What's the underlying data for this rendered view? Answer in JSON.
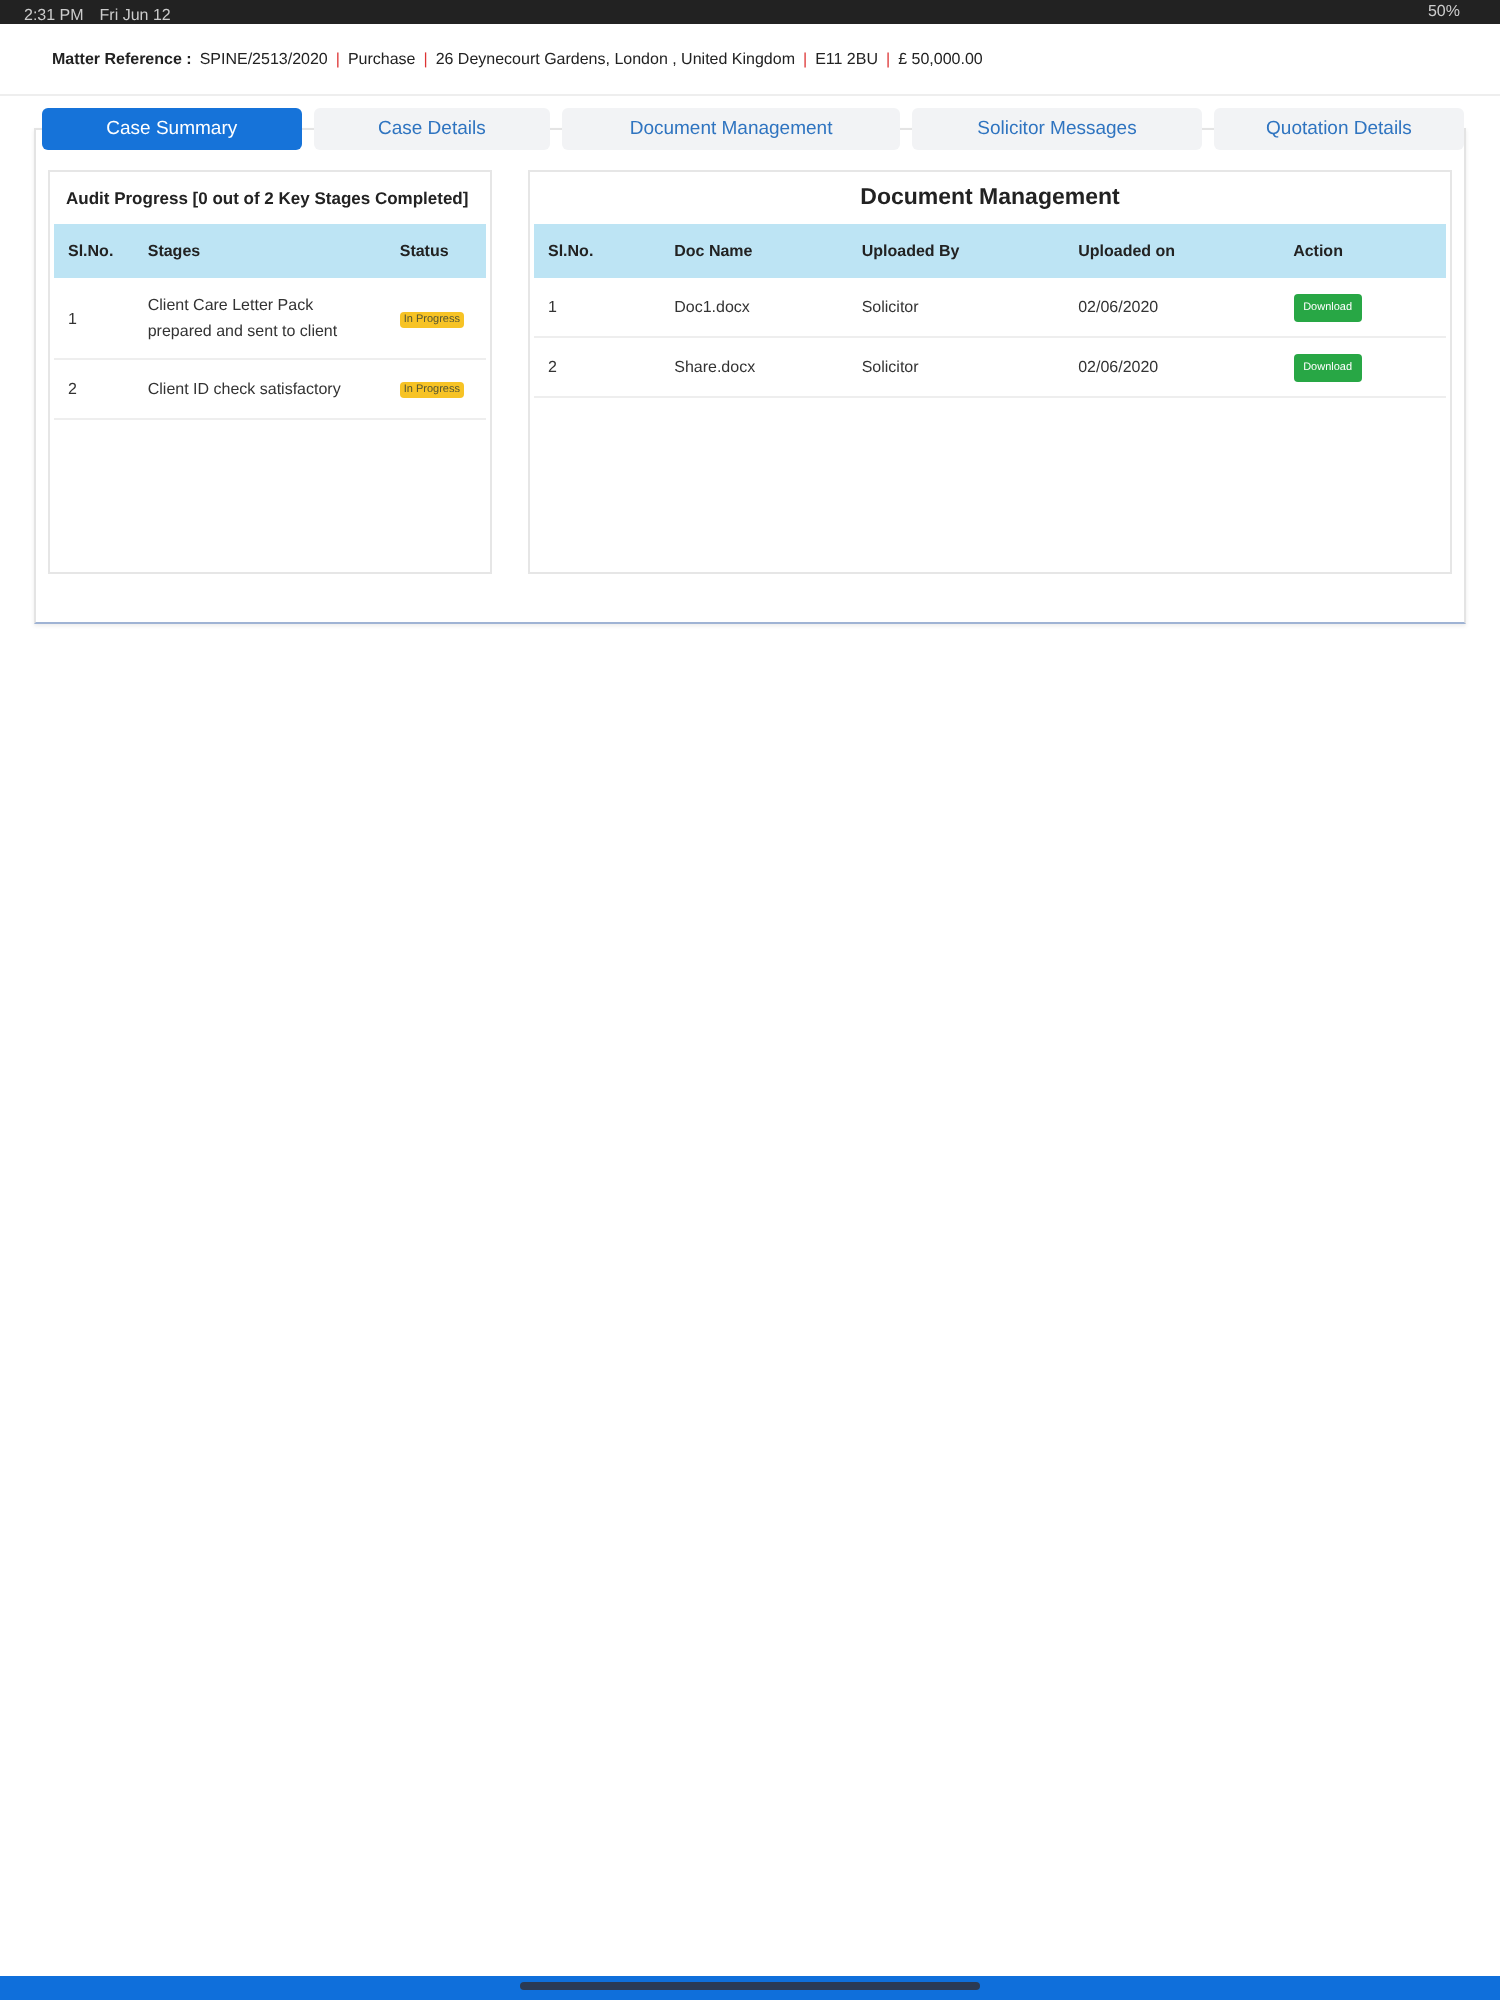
{
  "status_bar": {
    "time": "2:31 PM",
    "date": "Fri Jun 12",
    "battery": "50%"
  },
  "matter_reference": {
    "label": "Matter Reference :",
    "separator": "|",
    "parts": [
      "SPINE/2513/2020",
      "Purchase",
      "26 Deynecourt Gardens, London , United Kingdom",
      "E11 2BU",
      "£ 50,000.00"
    ]
  },
  "tabs": [
    {
      "label": "Case Summary",
      "selected": true
    },
    {
      "label": "Case Details",
      "selected": false
    },
    {
      "label": "Document Management",
      "selected": false
    },
    {
      "label": "Solicitor Messages",
      "selected": false
    },
    {
      "label": "Quotation Details",
      "selected": false
    }
  ],
  "audit": {
    "title": "Audit Progress [0 out of 2 Key Stages Completed]",
    "columns": [
      "Sl.No.",
      "Stages",
      "Status"
    ],
    "rows": [
      {
        "no": "1",
        "stage": "Client Care Letter Pack prepared and sent to client",
        "status": "In Progress"
      },
      {
        "no": "2",
        "stage": "Client ID check satisfactory",
        "status": "In Progress"
      }
    ]
  },
  "documents": {
    "title": "Document Management",
    "columns": [
      "Sl.No.",
      "Doc Name",
      "Uploaded By",
      "Uploaded on",
      "Action"
    ],
    "rows": [
      {
        "no": "1",
        "name": "Doc1.docx",
        "by": "Solicitor",
        "on": "02/06/2020",
        "action": "Download"
      },
      {
        "no": "2",
        "name": "Share.docx",
        "by": "Solicitor",
        "on": "02/06/2020",
        "action": "Download"
      }
    ]
  }
}
